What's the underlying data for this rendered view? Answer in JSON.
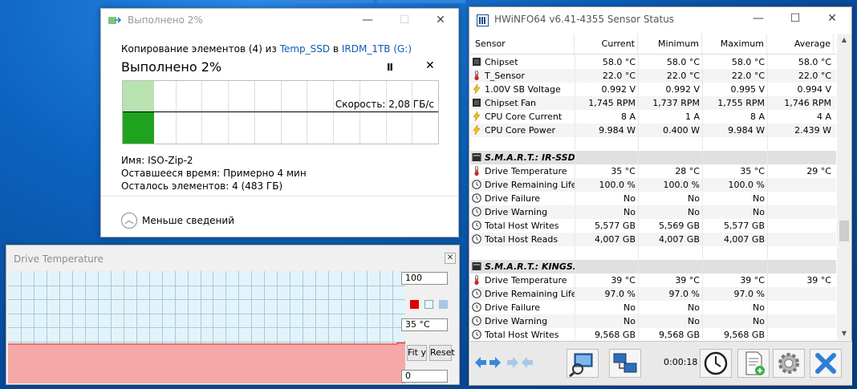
{
  "copy_dialog": {
    "title": "Выполнено 2%",
    "line_prefix": "Копирование элементов (4) из ",
    "source": "Temp_SSD",
    "in_word": " в ",
    "dest": "IRDM_1TB (G:)",
    "percent_text": "Выполнено 2%",
    "pause_label": "II",
    "stop_label": "✕",
    "speed_text": "Скорость: 2,08 ГБ/с",
    "name_label": "Имя:",
    "name_value": "ISO-Zip-2",
    "time_label": "Оставшееся время:",
    "time_value": "Примерно 4 мин",
    "items_label": "Осталось элементов:",
    "items_value": "4 (483 ГБ)",
    "less_details_label": "Меньше сведений",
    "progress_fraction": 0.02
  },
  "temp_graph": {
    "title": "Drive Temperature",
    "close_label": "✕",
    "max_value": "100",
    "current_value": "35 °C",
    "min_value": "0",
    "fit_label": "Fit y",
    "reset_label": "Reset",
    "colors": {
      "line": "#ff1010",
      "fill": "#f6a8a8",
      "bg": "#e2f4fa",
      "grid": "#a9c9d8",
      "swatch_red": "#e00000",
      "swatch_cyan": "#e8f8fc",
      "swatch_blue": "#a8c4e8"
    }
  },
  "chart_data": {
    "type": "area",
    "ylim": [
      0,
      100
    ],
    "values": [
      35,
      35,
      35,
      35,
      35,
      35,
      35,
      35,
      35,
      35,
      35,
      35,
      35,
      35,
      35,
      35,
      35,
      35,
      35,
      35,
      35,
      35,
      35,
      35,
      35,
      35,
      35,
      35,
      35,
      35,
      35,
      35,
      35,
      35,
      35,
      35,
      35,
      35,
      35,
      35,
      35,
      35,
      35,
      35,
      35,
      35,
      35,
      35,
      35,
      36,
      38
    ]
  },
  "hwinfo": {
    "title": "HWiNFO64 v6.41-4355 Sensor Status",
    "columns": [
      "Sensor",
      "Current",
      "Minimum",
      "Maximum",
      "Average"
    ],
    "rows": [
      {
        "icon": "chip",
        "name": "Chipset",
        "cur": "58.0 °C",
        "min": "58.0 °C",
        "max": "58.0 °C",
        "avg": "58.0 °C"
      },
      {
        "icon": "temp",
        "name": "T_Sensor",
        "cur": "22.0 °C",
        "min": "22.0 °C",
        "max": "22.0 °C",
        "avg": "22.0 °C"
      },
      {
        "icon": "bolt",
        "name": "1.00V SB Voltage",
        "cur": "0.992 V",
        "min": "0.992 V",
        "max": "0.995 V",
        "avg": "0.994 V"
      },
      {
        "icon": "chip",
        "name": "Chipset Fan",
        "cur": "1,745 RPM",
        "min": "1,737 RPM",
        "max": "1,755 RPM",
        "avg": "1,746 RPM"
      },
      {
        "icon": "bolt",
        "name": "CPU Core Current",
        "cur": "8 A",
        "min": "1 A",
        "max": "8 A",
        "avg": "4 A"
      },
      {
        "icon": "bolt",
        "name": "CPU Core Power",
        "cur": "9.984 W",
        "min": "0.400 W",
        "max": "9.984 W",
        "avg": "2.439 W"
      },
      {
        "icon": "none",
        "name": "",
        "cur": "",
        "min": "",
        "max": "",
        "avg": ""
      },
      {
        "icon": "drive",
        "name": "S.M.A.R.T.: IR-SSD...",
        "cur": "",
        "min": "",
        "max": "",
        "avg": "",
        "group": true
      },
      {
        "icon": "temp",
        "name": "Drive Temperature",
        "cur": "35 °C",
        "min": "28 °C",
        "max": "35 °C",
        "avg": "29 °C"
      },
      {
        "icon": "clock",
        "name": "Drive Remaining Life",
        "cur": "100.0 %",
        "min": "100.0 %",
        "max": "100.0 %",
        "avg": ""
      },
      {
        "icon": "clock",
        "name": "Drive Failure",
        "cur": "No",
        "min": "No",
        "max": "No",
        "avg": ""
      },
      {
        "icon": "clock",
        "name": "Drive Warning",
        "cur": "No",
        "min": "No",
        "max": "No",
        "avg": ""
      },
      {
        "icon": "clock",
        "name": "Total Host Writes",
        "cur": "5,577 GB",
        "min": "5,569 GB",
        "max": "5,577 GB",
        "avg": ""
      },
      {
        "icon": "clock",
        "name": "Total Host Reads",
        "cur": "4,007 GB",
        "min": "4,007 GB",
        "max": "4,007 GB",
        "avg": ""
      },
      {
        "icon": "none",
        "name": "",
        "cur": "",
        "min": "",
        "max": "",
        "avg": ""
      },
      {
        "icon": "drive",
        "name": "S.M.A.R.T.: KINGS...",
        "cur": "",
        "min": "",
        "max": "",
        "avg": "",
        "group": true
      },
      {
        "icon": "temp",
        "name": "Drive Temperature",
        "cur": "39 °C",
        "min": "39 °C",
        "max": "39 °C",
        "avg": "39 °C"
      },
      {
        "icon": "clock",
        "name": "Drive Remaining Life",
        "cur": "97.0 %",
        "min": "97.0 %",
        "max": "97.0 %",
        "avg": ""
      },
      {
        "icon": "clock",
        "name": "Drive Failure",
        "cur": "No",
        "min": "No",
        "max": "No",
        "avg": ""
      },
      {
        "icon": "clock",
        "name": "Drive Warning",
        "cur": "No",
        "min": "No",
        "max": "No",
        "avg": ""
      },
      {
        "icon": "clock",
        "name": "Total Host Writes",
        "cur": "9,568 GB",
        "min": "9,568 GB",
        "max": "9,568 GB",
        "avg": ""
      }
    ],
    "elapsed": "0:00:18",
    "icons": {
      "chip": "chip-icon",
      "temp": "thermometer-icon",
      "bolt": "bolt-icon",
      "clock": "clock-icon",
      "drive": "drive-icon"
    }
  }
}
